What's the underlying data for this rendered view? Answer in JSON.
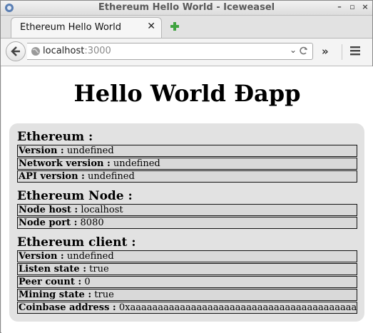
{
  "window": {
    "title": "Ethereum Hello World - Iceweasel"
  },
  "tab": {
    "label": "Ethereum Hello World"
  },
  "address": {
    "host": "localhost",
    "port": ":3000"
  },
  "page": {
    "title": "Hello World Đapp",
    "sections": [
      {
        "title": "Ethereum :",
        "rows": [
          {
            "label": "Version :",
            "value": "undefined"
          },
          {
            "label": "Network version :",
            "value": "undefined"
          },
          {
            "label": "API version :",
            "value": "undefined"
          }
        ]
      },
      {
        "title": "Ethereum Node :",
        "rows": [
          {
            "label": "Node host :",
            "value": "localhost"
          },
          {
            "label": "Node port :",
            "value": "8080"
          }
        ]
      },
      {
        "title": "Ethereum client :",
        "rows": [
          {
            "label": "Version :",
            "value": "undefined"
          },
          {
            "label": "Listen state :",
            "value": "true"
          },
          {
            "label": "Peer count :",
            "value": "0"
          },
          {
            "label": "Mining state :",
            "value": "true"
          },
          {
            "label": "Coinbase address :",
            "value": "0xaaaaaaaaaaaaaaaaaaaaaaaaaaaaaaaaaaaaaaaaaa"
          }
        ]
      }
    ]
  }
}
